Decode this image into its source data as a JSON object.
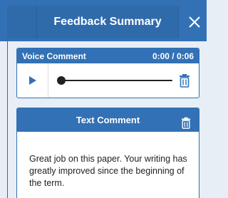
{
  "header": {
    "title": "Feedback Summary",
    "close_icon": "close-icon"
  },
  "voice_comment": {
    "label": "Voice Comment",
    "time": "0:00 / 0:06",
    "progress": 0,
    "icons": [
      "play-icon",
      "trash-icon"
    ]
  },
  "text_comment": {
    "label": "Text Comment",
    "body": "Great job on this paper. Your writing has greatly improved since the beginning of the term.",
    "icons": [
      "trash-icon"
    ]
  },
  "colors": {
    "accent": "#3271b5",
    "accent_dark": "#2f6aab",
    "icon_blue": "#3271b5"
  }
}
